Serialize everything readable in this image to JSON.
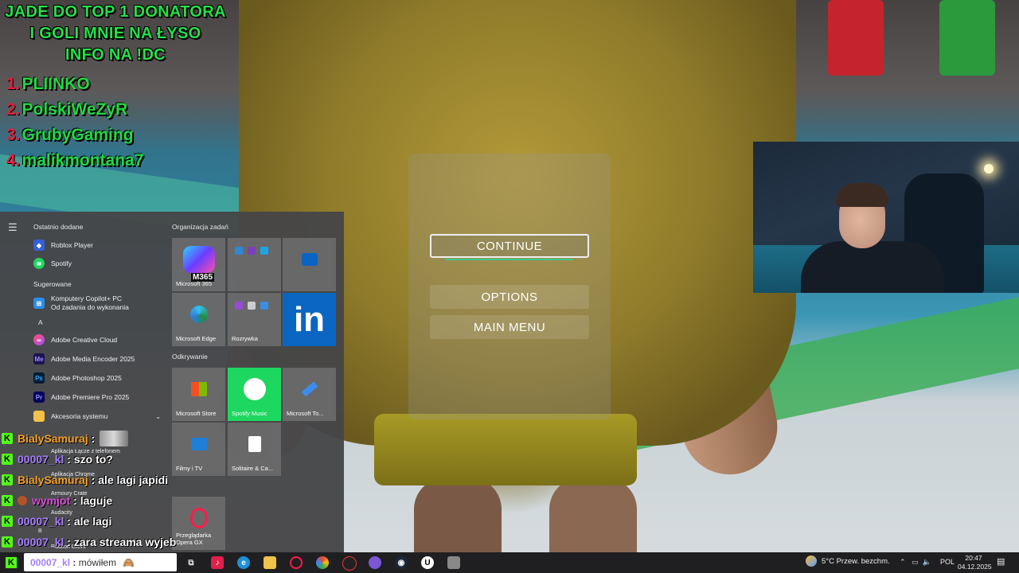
{
  "overlay": {
    "title_lines": [
      "JADE DO TOP 1 DONATORA",
      "I GOLI MNIE NA ŁYSO",
      "INFO NA !DC"
    ],
    "donors": [
      {
        "rank": "1.",
        "name": "PLIINKO"
      },
      {
        "rank": "2.",
        "name": "PolskiWeZyR"
      },
      {
        "rank": "3.",
        "name": "GrubyGaming"
      },
      {
        "rank": "4.",
        "name": "malikmontana7"
      }
    ],
    "colors": {
      "green": "#25e04a",
      "red": "#e0203a"
    }
  },
  "pause_menu": {
    "continue": "CONTINUE",
    "options": "OPTIONS",
    "main_menu": "MAIN MENU"
  },
  "start_menu": {
    "recent_header": "Ostatnio dodane",
    "suggested_header": "Sugerowane",
    "letter_a": "A",
    "letter_b": "B",
    "apps": {
      "roblox": "Roblox Player",
      "spotify": "Spotify",
      "copilot_line1": "Komputery Copilot+ PC",
      "copilot_line2": "Od zadania do wykonania",
      "adobe_cc": "Adobe Creative Cloud",
      "adobe_me": "Adobe Media Encoder 2025",
      "adobe_ps": "Adobe Photoshop 2025",
      "adobe_pr": "Adobe Premiere Pro 2025",
      "accessories": "Akcesoria systemu",
      "phone_link": "Aplikacja Łącze z telefonem",
      "chrome": "Aplikacja Chrome",
      "armoury": "Armoury Crate",
      "audacity": "Audacity",
      "radlion": "Radlion Client"
    },
    "tiles_header_1": "Organizacja zadań",
    "tiles_header_2": "Odkrywanie",
    "tiles": {
      "m365": "Microsoft 365",
      "m365_badge": "M365",
      "edge": "Microsoft Edge",
      "rozrywka": "Rozrywka",
      "store": "Microsoft Store",
      "spotify_music": "Spotify Music",
      "todo": "Microsoft To...",
      "films": "Filmy i TV",
      "solitaire": "Solitaire & Ca...",
      "opera": "Przeglądarka Opera GX",
      "linkedin": "in"
    }
  },
  "chat": [
    {
      "user": "BialySamuraj",
      "color": "#f2a02a",
      "message": "",
      "emote": true
    },
    {
      "user": "00007_kl",
      "color": "#a67cff",
      "message": "szo to?"
    },
    {
      "user": "BialySamuraj",
      "color": "#f2a02a",
      "message": "ale lagi japidi"
    },
    {
      "user": "wymjot",
      "color": "#d64ad6",
      "message": "laguje",
      "badge": true
    },
    {
      "user": "00007_kl",
      "color": "#a67cff",
      "message": "ale lagi"
    },
    {
      "user": "00007_kl",
      "color": "#a67cff",
      "message": "zara streama wyjeb"
    },
    {
      "user": "00007_kl",
      "color": "#a67cff",
      "message": "mówiłem"
    }
  ],
  "chat_badge": "K",
  "taskbar": {
    "weather": "5°C  Przew. bezchm.",
    "lang": "POL",
    "time": "20:47",
    "date": "04.12.2025"
  }
}
